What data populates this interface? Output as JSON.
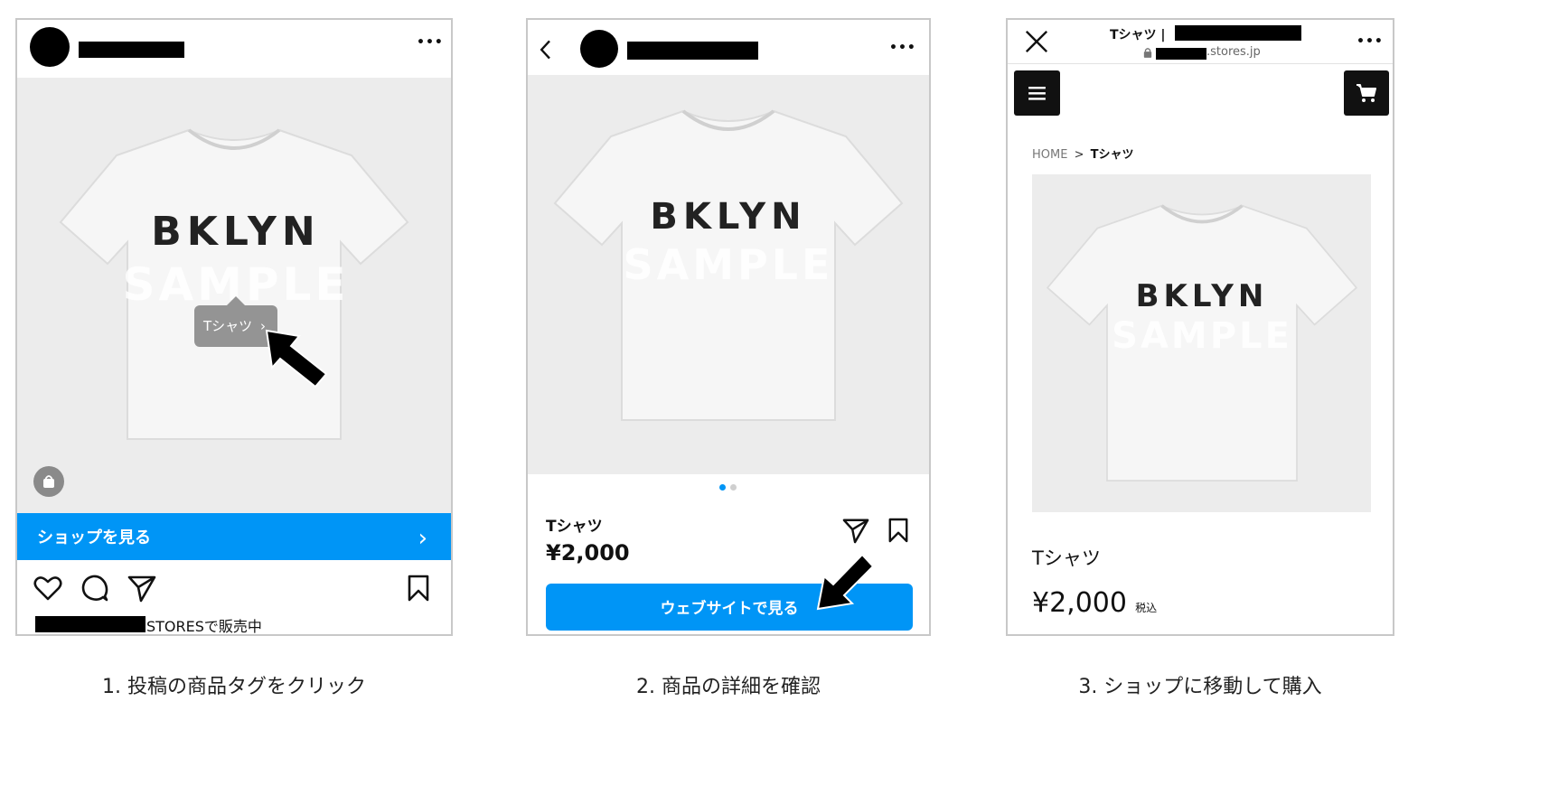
{
  "panel1": {
    "tag_label": "Tシャツ",
    "tag_chevron": "›",
    "shop_bar_label": "ショップを見る",
    "shop_bar_chevron": "›",
    "caption_suffix": "STORESで販売中",
    "icons": [
      "more-dots-icon",
      "shopping-bag-icon",
      "heart-icon",
      "comment-icon",
      "send-icon",
      "bookmark-icon",
      "pointer-arrow-icon"
    ],
    "more_label": "•••"
  },
  "panel2": {
    "back_label": "‹",
    "more_label": "•••",
    "product_name": "Tシャツ",
    "price": "¥2,000",
    "button_label": "ウェブサイトで見る",
    "pagination": {
      "count": 2,
      "active": 1
    },
    "icons": [
      "back-icon",
      "more-dots-icon",
      "send-icon",
      "bookmark-icon",
      "pointer-arrow-icon"
    ]
  },
  "panel3": {
    "title_prefix": "Tシャツ |",
    "domain_suffix": ".stores.jp",
    "more_label": "•••",
    "breadcrumb_home": "HOME",
    "breadcrumb_sep": ">",
    "breadcrumb_current": "Tシャツ",
    "product_name": "Tシャツ",
    "price": "¥2,000",
    "tax_label": "税込",
    "icons": [
      "close-icon",
      "lock-icon",
      "menu-icon",
      "cart-icon"
    ]
  },
  "shirt": {
    "brand": "BKLYN",
    "watermark": "SAMPLE"
  },
  "captions": {
    "step1": "1. 投稿の商品タグをクリック",
    "step2": "2. 商品の詳細を確認",
    "step3": "3. ショップに移動して購入"
  },
  "colors": {
    "accent": "#0095f6",
    "border": "#c8c8c8",
    "photo_bg": "#ececec"
  }
}
